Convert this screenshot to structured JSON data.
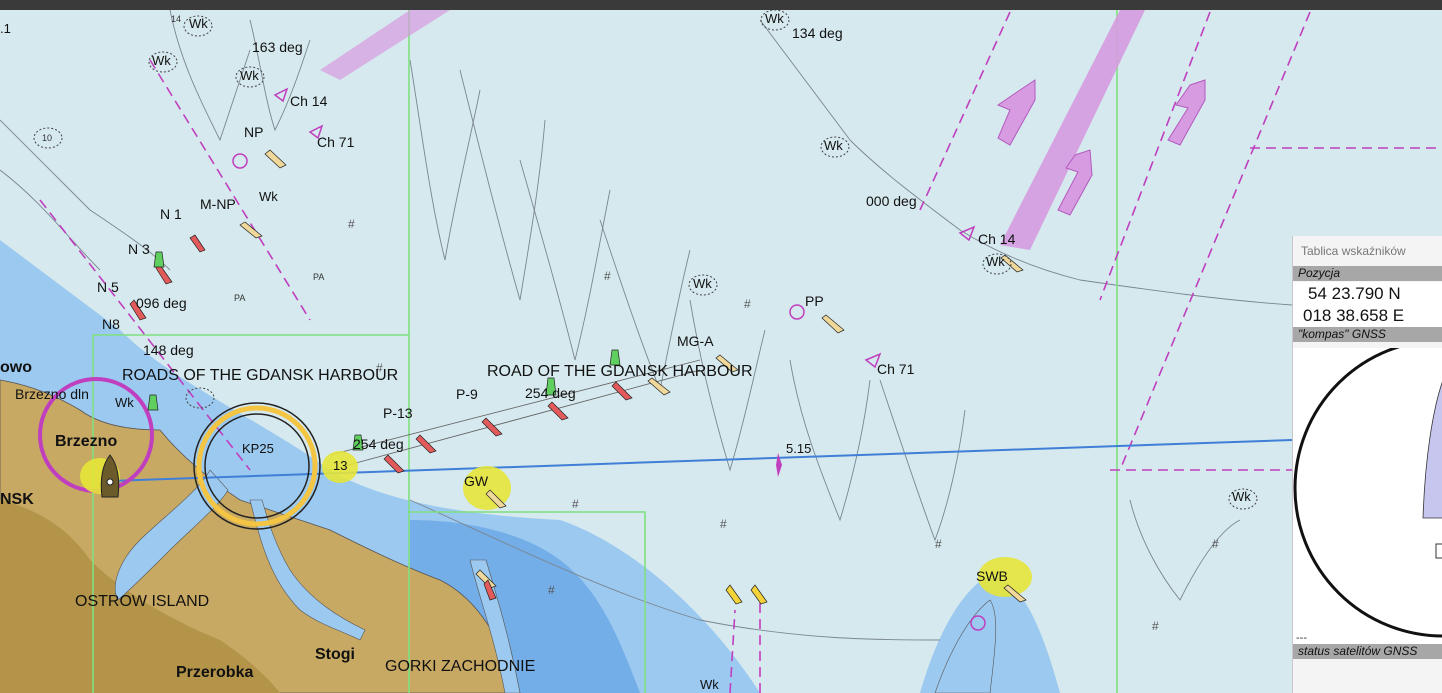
{
  "labels": {
    "wk_top1": "Wk",
    "wk_top2": "Wk",
    "wk_top3": "Wk",
    "wk_mid": "Wk",
    "wk_pp": "Wk",
    "wk_ch14": "Wk",
    "wk_right": "Wk",
    "wk_bottom": "Wk",
    "wk_mnp": "Wk",
    "wk_shore": "Wk",
    "deg_163": "163 deg",
    "deg_134": "134 deg",
    "deg_000": "000 deg",
    "deg_096": "096 deg",
    "deg_148": "148 deg",
    "deg_254a": "254 deg",
    "deg_254b": "254 deg",
    "ch14_a": "Ch 14",
    "ch71_a": "Ch 71",
    "ch14_b": "Ch 14",
    "ch71_b": "Ch 71",
    "np": "NP",
    "mnp": "M-NP",
    "n1": "N 1",
    "n3": "N 3",
    "n5": "N 5",
    "n8": "N8",
    "pp": "PP",
    "mga": "MG-A",
    "p9": "P-9",
    "p13": "P-13",
    "gw": "GW",
    "swb": "SWB",
    "depth_515": "5.15",
    "roads1": "ROADS OF THE GDANSK HARBOUR",
    "roads2": "ROAD OF THE GDANSK HARBOUR",
    "brzezno_dln": "Brzezno dln",
    "brzezno": "Brzezno",
    "nsk": "NSK",
    "owo": "owo",
    "ostrow": "OSTROW ISLAND",
    "przerobka": "Przerobka",
    "stogi": "Stogi",
    "gorki": "GORKI ZACHODNIE",
    "kp25": "KP25",
    "n13": "13",
    "pa1": "PA",
    "pa2": "PA",
    "d10": "10",
    "d14": "14",
    "d1": ".1"
  },
  "panel": {
    "title": "Tablica wskaźników",
    "position_label": "Pozycja",
    "lat": "54 23.790 N",
    "lon": "018 38.658 E",
    "compass_label": "\"kompas\" GNSS",
    "status_label": "status satelitów GNSS",
    "dashes": "---"
  },
  "colors": {
    "shallow": "#9cc9f0",
    "water": "#d6e9ee",
    "land": "#c8a964",
    "route": "#3f7fd8",
    "tss": "#d69be0",
    "boundary": "#bf3fbf",
    "ownship": "#e0ce28",
    "grid": "#7fe07f"
  }
}
